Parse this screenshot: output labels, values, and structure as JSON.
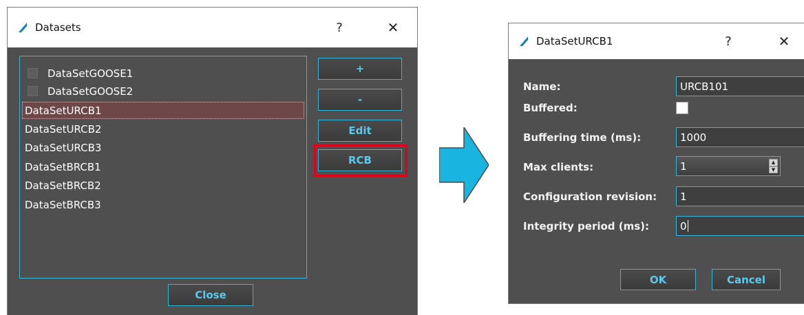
{
  "datasets_dialog": {
    "title": "Datasets",
    "help": "?",
    "close_glyph": "✕",
    "items": [
      {
        "label": "DataSetGOOSE1",
        "checkbox": true,
        "selected": false
      },
      {
        "label": "DataSetGOOSE2",
        "checkbox": true,
        "selected": false
      },
      {
        "label": "DataSetURCB1",
        "checkbox": false,
        "selected": true
      },
      {
        "label": "DataSetURCB2",
        "checkbox": false,
        "selected": false
      },
      {
        "label": "DataSetURCB3",
        "checkbox": false,
        "selected": false
      },
      {
        "label": "DataSetBRCB1",
        "checkbox": false,
        "selected": false
      },
      {
        "label": "DataSetBRCB2",
        "checkbox": false,
        "selected": false
      },
      {
        "label": "DataSetBRCB3",
        "checkbox": false,
        "selected": false
      }
    ],
    "buttons": {
      "add": "+",
      "remove": "-",
      "edit": "Edit",
      "rcb": "RCB"
    },
    "close_button": "Close",
    "highlight_color": "#e0001b"
  },
  "arrow": {
    "color": "#19b4e0",
    "icon": "right-arrow-icon"
  },
  "urcb_dialog": {
    "title": "DataSetURCB1",
    "help": "?",
    "close_glyph": "✕",
    "fields": {
      "name": {
        "label": "Name:",
        "value": "URCB101"
      },
      "buffered": {
        "label": "Buffered:",
        "checked": false
      },
      "buffering_time": {
        "label": "Buffering time (ms):",
        "value": "1000"
      },
      "max_clients": {
        "label": "Max clients:",
        "value": "1"
      },
      "config_revision": {
        "label": "Configuration revision:",
        "value": "1"
      },
      "integrity_period": {
        "label": "Integrity period (ms):",
        "value": "0"
      }
    },
    "ok": "OK",
    "cancel": "Cancel"
  },
  "colors": {
    "accent": "#35b6d8",
    "dialog_bg": "#4f4f4f",
    "selected_row": "#6e4848"
  }
}
